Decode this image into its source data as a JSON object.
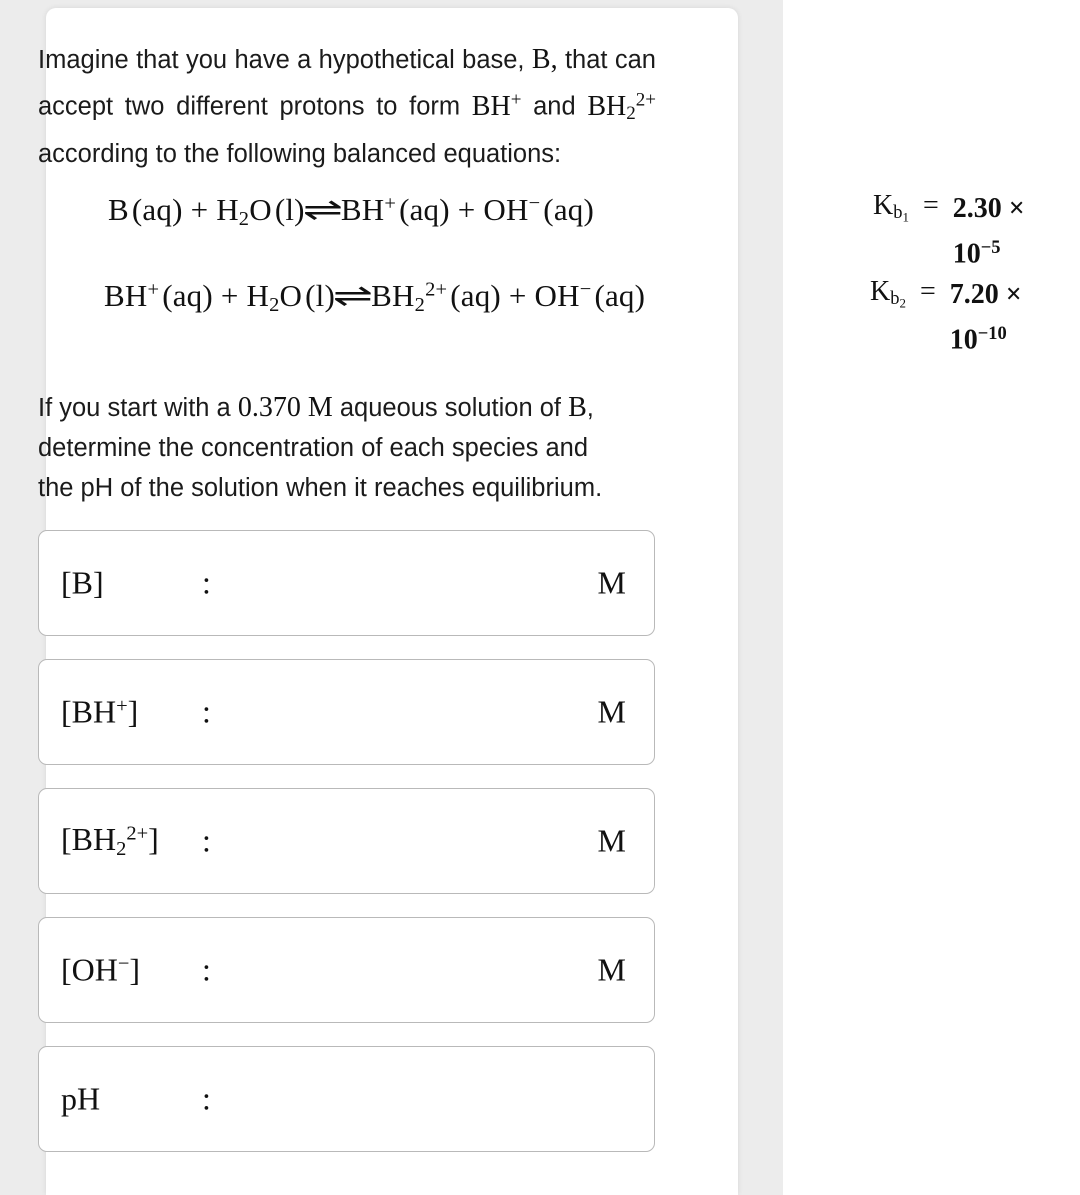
{
  "page": {
    "background_color": "#ffffff",
    "gutter_color": "#ececec",
    "card_color": "#ffffff",
    "border_color": "#b9b9b9",
    "text_color": "#1b1b1b"
  },
  "problem": {
    "intro_line1": "Imagine that you have a hypothetical base,",
    "intro_base_symbol": "B,",
    "intro_line1_tail": "that",
    "intro_line2_head": "can accept two different protons to form",
    "intro_species1": "BH",
    "intro_species1_charge": "+",
    "intro_line2_tail": "and",
    "intro_species2_base": "BH",
    "intro_species2_sub": "2",
    "intro_species2_charge": "2+",
    "intro_line3_tail": "according to the following balanced",
    "intro_line4": "equations:",
    "question_head": "If you start with a",
    "question_concentration": "0.370 M",
    "question_mid": "aqueous solution of",
    "question_species": "B",
    "question_comma": ",",
    "question_line2": "determine the concentration of each species and",
    "question_line3": "the pH of the solution when it reaches equilibrium."
  },
  "equations": [
    {
      "id": "equation-1",
      "reactant1": "B",
      "reactant1_state": "(aq)",
      "plus": "+",
      "reactant2": "H",
      "reactant2_sub": "2",
      "reactant2_tail": "O",
      "reactant2_state": "(l)",
      "arrow": "equilibrium-harpoon",
      "product1": "BH",
      "product1_charge": "+",
      "product1_state": "(aq)",
      "product2": "OH",
      "product2_charge": "−",
      "product2_state": "(aq)",
      "constant_symbol": "K",
      "constant_sub": "b",
      "constant_subsub": "1",
      "equals": "=",
      "constant_mantissa": "2.30",
      "constant_times": "×",
      "constant_base": "10",
      "constant_exponent": "−5"
    },
    {
      "id": "equation-2",
      "reactant1": "BH",
      "reactant1_charge": "+",
      "reactant1_state": "(aq)",
      "plus": "+",
      "reactant2": "H",
      "reactant2_sub": "2",
      "reactant2_tail": "O",
      "reactant2_state": "(l)",
      "arrow": "equilibrium-harpoon",
      "product1": "BH",
      "product1_sub": "2",
      "product1_charge": "2+",
      "product1_state": "(aq)",
      "product2": "OH",
      "product2_charge": "−",
      "product2_state": "(aq)",
      "constant_symbol": "K",
      "constant_sub": "b",
      "constant_subsub": "2",
      "equals": "=",
      "constant_mantissa": "7.20",
      "constant_times": "×",
      "constant_base": "10",
      "constant_exponent": "−10"
    }
  ],
  "answers": [
    {
      "id": "answer-b",
      "label_open": "[",
      "label_species": "B",
      "label_close": "]",
      "colon": ":",
      "value": "",
      "placeholder": "",
      "unit": "M"
    },
    {
      "id": "answer-bh-plus",
      "label_open": "[",
      "label_species": "BH",
      "label_charge": "+",
      "label_close": "]",
      "colon": ":",
      "value": "",
      "placeholder": "",
      "unit": "M"
    },
    {
      "id": "answer-bh2-2plus",
      "label_open": "[",
      "label_species": "BH",
      "label_sub": "2",
      "label_charge": "2+",
      "label_close": "]",
      "colon": ":",
      "value": "",
      "placeholder": "",
      "unit": "M"
    },
    {
      "id": "answer-oh-minus",
      "label_open": "[",
      "label_species": "OH",
      "label_charge": "−",
      "label_close": "]",
      "colon": ":",
      "value": "",
      "placeholder": "",
      "unit": "M"
    },
    {
      "id": "answer-ph",
      "label_species": "pH",
      "colon": ":",
      "value": "",
      "placeholder": "",
      "unit": ""
    }
  ]
}
